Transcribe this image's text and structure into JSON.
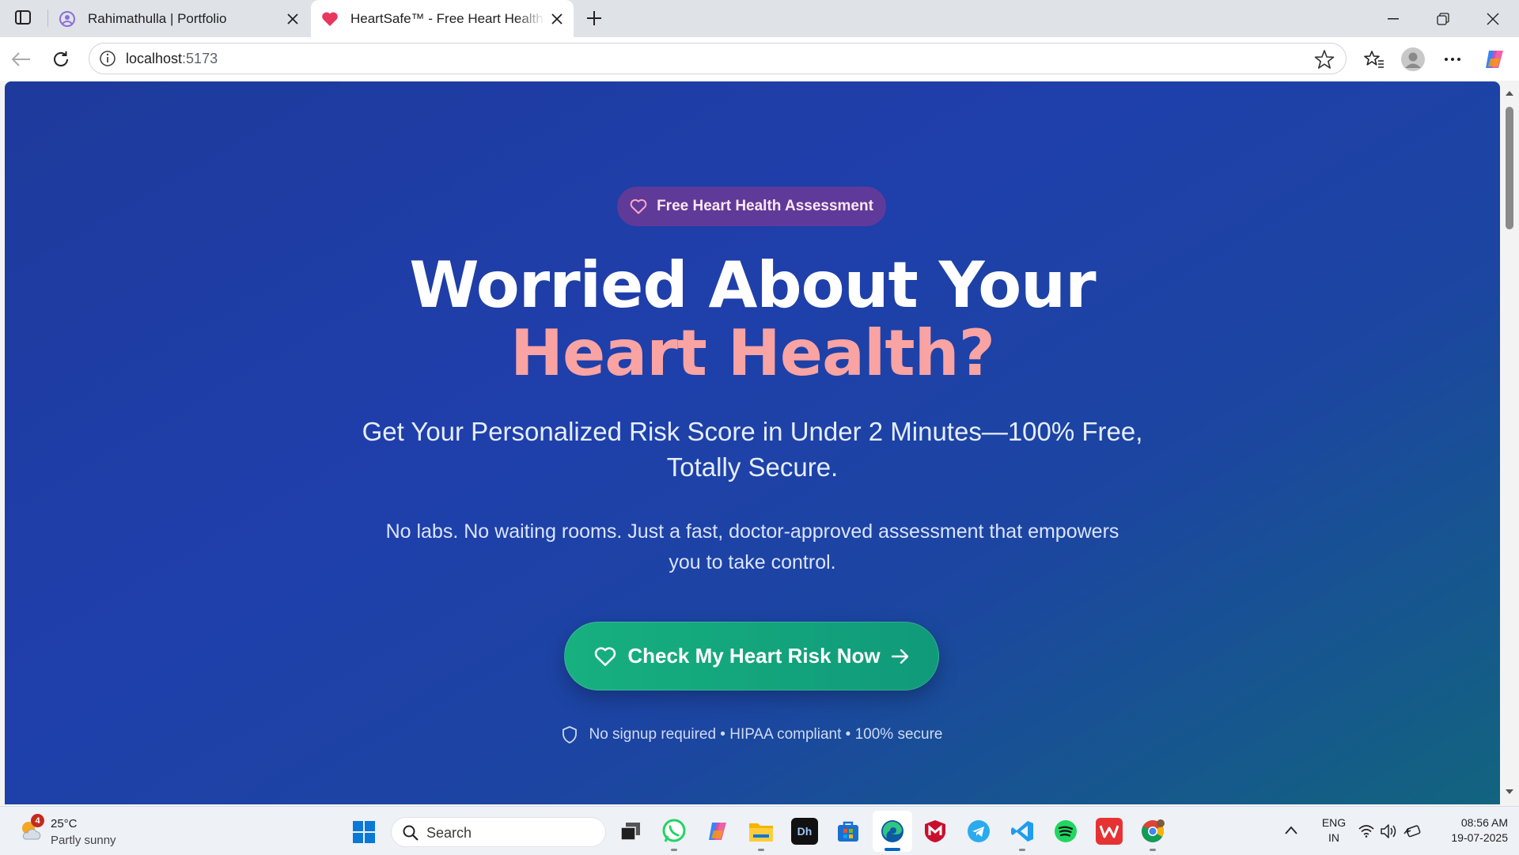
{
  "browser": {
    "tabs": [
      {
        "title": "Rahimathulla | Portfolio",
        "active": false
      },
      {
        "title": "HeartSafe™ - Free Heart Health Risk",
        "active": true
      }
    ],
    "address": {
      "host": "localhost",
      "port": ":5173"
    }
  },
  "page": {
    "badge": "Free Heart Health Assessment",
    "headline_line1": "Worried About Your",
    "headline_line2": "Heart Health?",
    "subheadline": "Get Your Personalized Risk Score in Under 2 Minutes—100% Free, Totally Secure.",
    "description": "No labs. No waiting rooms. Just a fast, doctor-approved assessment that empowers you to take control.",
    "cta_label": "Check My Heart Risk Now",
    "trust_line": "No signup required • HIPAA compliant • 100% secure",
    "colors": {
      "accent_pink": "#f9a3a3",
      "cta_green": "#17b07f",
      "bg_blue": "#1f3fab"
    }
  },
  "taskbar": {
    "weather": {
      "temp": "25°C",
      "condition": "Partly sunny",
      "badge": "4"
    },
    "search_placeholder": "Search",
    "apps": [
      "task-view",
      "whatsapp",
      "copilot",
      "file-explorer",
      "dh-app",
      "microsoft-store",
      "edge",
      "mcafee",
      "telegram",
      "vscode",
      "spotify",
      "wps-office",
      "chrome"
    ],
    "lang": {
      "line1": "ENG",
      "line2": "IN"
    },
    "clock": {
      "time": "08:56 AM",
      "date": "19-07-2025"
    }
  }
}
